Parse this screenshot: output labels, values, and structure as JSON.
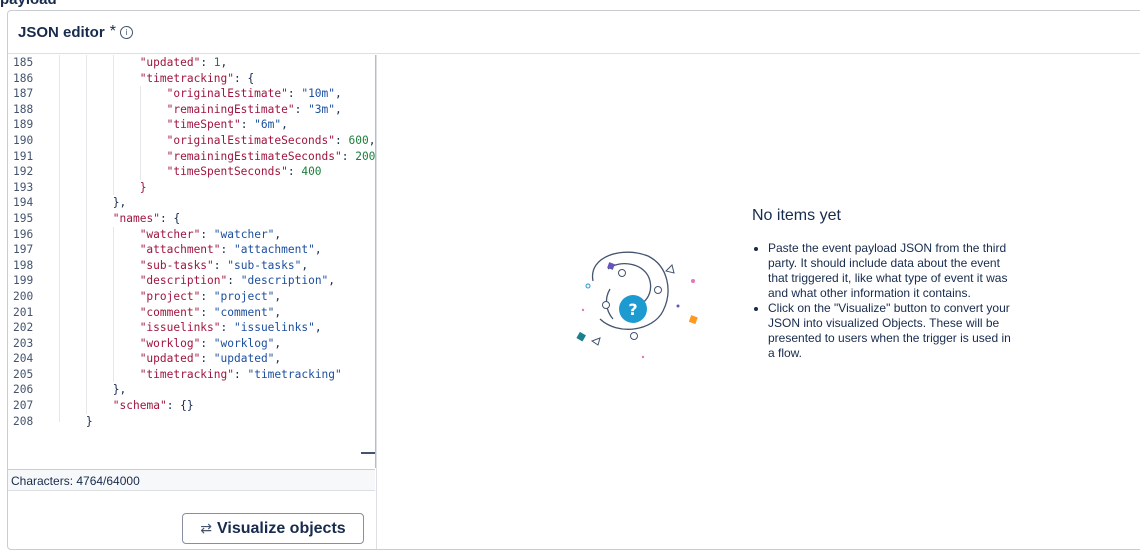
{
  "page": {
    "top_label": "payload"
  },
  "header": {
    "title": "JSON editor",
    "required_mark": "*",
    "info_icon": "info-icon"
  },
  "editor": {
    "lines": [
      {
        "n": "185",
        "indent": 3,
        "key": "\"updated\"",
        "val": "1",
        "vtype": "n",
        "tail": ","
      },
      {
        "n": "186",
        "indent": 3,
        "key": "\"timetracking\"",
        "val": "{",
        "vtype": "p",
        "tail": ""
      },
      {
        "n": "187",
        "indent": 4,
        "key": "\"originalEstimate\"",
        "val": "\"10m\"",
        "vtype": "s",
        "tail": ","
      },
      {
        "n": "188",
        "indent": 4,
        "key": "\"remainingEstimate\"",
        "val": "\"3m\"",
        "vtype": "s",
        "tail": ","
      },
      {
        "n": "189",
        "indent": 4,
        "key": "\"timeSpent\"",
        "val": "\"6m\"",
        "vtype": "s",
        "tail": ","
      },
      {
        "n": "190",
        "indent": 4,
        "key": "\"originalEstimateSeconds\"",
        "val": "600",
        "vtype": "n",
        "tail": ","
      },
      {
        "n": "191",
        "indent": 4,
        "key": "\"remainingEstimateSeconds\"",
        "val": "200",
        "vtype": "n",
        "tail": ","
      },
      {
        "n": "192",
        "indent": 4,
        "key": "\"timeSpentSeconds\"",
        "val": "400",
        "vtype": "n",
        "tail": ""
      },
      {
        "n": "193",
        "indent": 3,
        "key": "",
        "val": "}",
        "vtype": "k",
        "tail": ""
      },
      {
        "n": "194",
        "indent": 2,
        "key": "",
        "val": "}",
        "vtype": "p",
        "tail": ","
      },
      {
        "n": "195",
        "indent": 2,
        "key": "\"names\"",
        "val": "{",
        "vtype": "p",
        "tail": ""
      },
      {
        "n": "196",
        "indent": 3,
        "key": "\"watcher\"",
        "val": "\"watcher\"",
        "vtype": "s",
        "tail": ","
      },
      {
        "n": "197",
        "indent": 3,
        "key": "\"attachment\"",
        "val": "\"attachment\"",
        "vtype": "s",
        "tail": ","
      },
      {
        "n": "198",
        "indent": 3,
        "key": "\"sub-tasks\"",
        "val": "\"sub-tasks\"",
        "vtype": "s",
        "tail": ","
      },
      {
        "n": "199",
        "indent": 3,
        "key": "\"description\"",
        "val": "\"description\"",
        "vtype": "s",
        "tail": ","
      },
      {
        "n": "200",
        "indent": 3,
        "key": "\"project\"",
        "val": "\"project\"",
        "vtype": "s",
        "tail": ","
      },
      {
        "n": "201",
        "indent": 3,
        "key": "\"comment\"",
        "val": "\"comment\"",
        "vtype": "s",
        "tail": ","
      },
      {
        "n": "202",
        "indent": 3,
        "key": "\"issuelinks\"",
        "val": "\"issuelinks\"",
        "vtype": "s",
        "tail": ","
      },
      {
        "n": "203",
        "indent": 3,
        "key": "\"worklog\"",
        "val": "\"worklog\"",
        "vtype": "s",
        "tail": ","
      },
      {
        "n": "204",
        "indent": 3,
        "key": "\"updated\"",
        "val": "\"updated\"",
        "vtype": "s",
        "tail": ","
      },
      {
        "n": "205",
        "indent": 3,
        "key": "\"timetracking\"",
        "val": "\"timetracking\"",
        "vtype": "s",
        "tail": ""
      },
      {
        "n": "206",
        "indent": 2,
        "key": "",
        "val": "}",
        "vtype": "p",
        "tail": ","
      },
      {
        "n": "207",
        "indent": 2,
        "key": "\"schema\"",
        "val": "{}",
        "vtype": "p",
        "tail": ""
      },
      {
        "n": "208",
        "indent": 1,
        "key": "",
        "val": "}",
        "vtype": "p",
        "tail": ""
      }
    ],
    "char_count": "Characters: 4764/64000",
    "visualize_icon": "swap-arrows-icon",
    "visualize_label": "Visualize objects"
  },
  "empty_state": {
    "title": "No items yet",
    "bullets": [
      "Paste the event payload JSON from the third party. It should include data about the event that triggered it, like what type of event it was and what other information it contains.",
      "Click on the \"Visualize\" button to convert your JSON into visualized Objects. These will be presented to users when the trigger is used in a flow."
    ],
    "illustration": "question-orbit-illustration"
  },
  "colors": {
    "key": "#a0153e",
    "string": "#1c4fa0",
    "number": "#1a7f3a",
    "text": "#172b4d"
  }
}
